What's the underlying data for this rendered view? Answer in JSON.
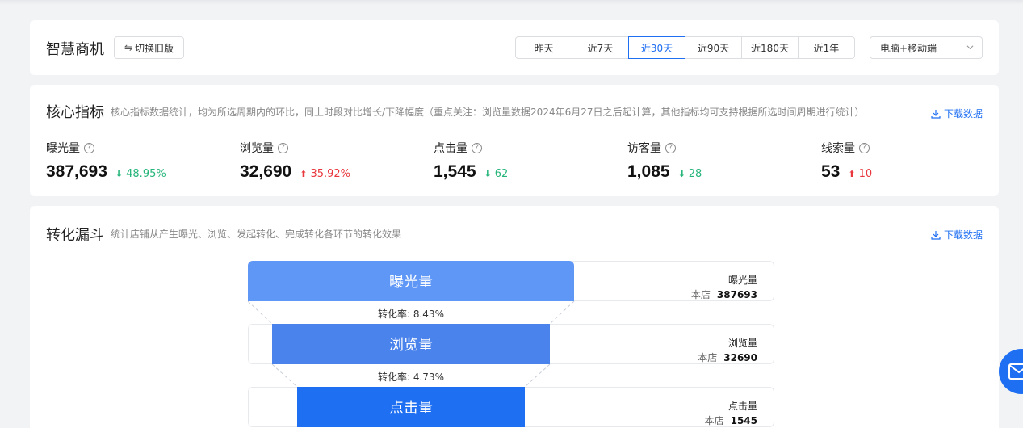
{
  "header": {
    "title": "智慧商机",
    "switch_label": "切换旧版",
    "date_tabs": [
      "昨天",
      "近7天",
      "近30天",
      "近90天",
      "近180天",
      "近1年"
    ],
    "active_tab": "近30天",
    "device": "电脑+移动端"
  },
  "metrics_section": {
    "title": "核心指标",
    "desc": "核心指标数据统计，均为所选周期内的环比，同上时段对比增长/下降幅度（重点关注：浏览量数据2024年6月27日之后起计算，其他指标均可支持根据所选时间周期进行统计）",
    "download": "下载数据",
    "items": [
      {
        "label": "曝光量",
        "value": "387,693",
        "change": "48.95%",
        "direction": "down"
      },
      {
        "label": "浏览量",
        "value": "32,690",
        "change": "35.92%",
        "direction": "up"
      },
      {
        "label": "点击量",
        "value": "1,545",
        "change": "62",
        "direction": "down"
      },
      {
        "label": "访客量",
        "value": "1,085",
        "change": "28",
        "direction": "down"
      },
      {
        "label": "线索量",
        "value": "53",
        "change": "10",
        "direction": "up"
      }
    ]
  },
  "funnel_section": {
    "title": "转化漏斗",
    "desc": "统计店铺从产生曝光、浏览、发起转化、完成转化各环节的转化效果",
    "download": "下载数据",
    "store_label": "本店",
    "steps": [
      {
        "label": "曝光量",
        "value": "387693",
        "color": "#5f97f7"
      },
      {
        "label": "浏览量",
        "value": "32690",
        "color": "#4a83ec"
      },
      {
        "label": "点击量",
        "value": "1545",
        "color": "#1f6ff2"
      }
    ],
    "rates": [
      "转化率: 8.43%",
      "转化率: 4.73%"
    ]
  },
  "colors": {
    "accent": "#1f6ff2",
    "down": "#26b57a",
    "up": "#e8383d"
  }
}
